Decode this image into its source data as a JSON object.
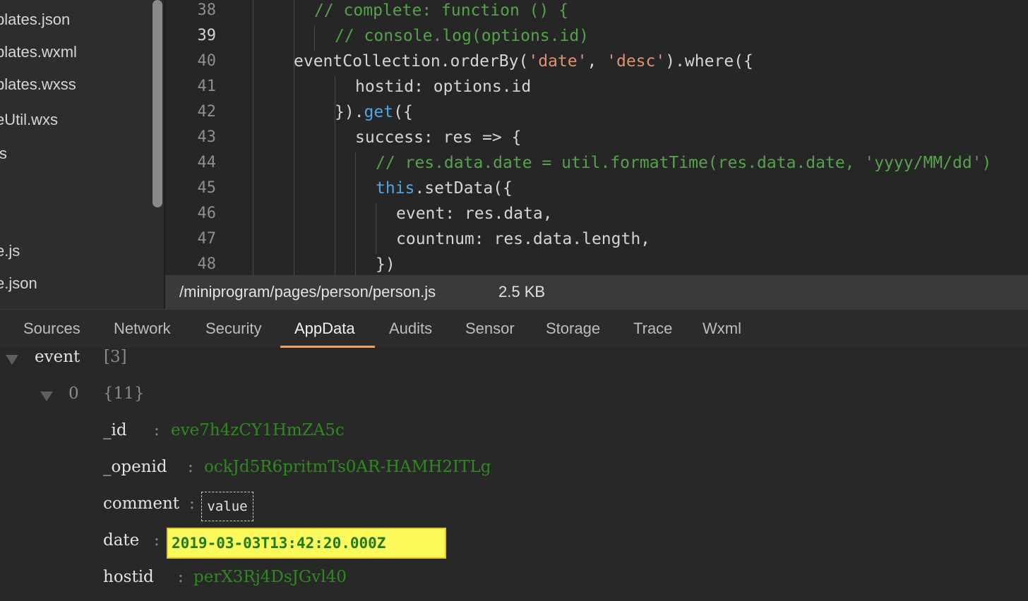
{
  "file_tree": {
    "items": [
      "plates.json",
      "plates.wxml",
      "plates.wxss",
      "eUtil.wxs",
      "js",
      "e.js",
      "e.json"
    ]
  },
  "editor": {
    "lines": [
      {
        "num": "38",
        "tokens": [
          {
            "t": "// complete: function () {",
            "c": "comment"
          }
        ]
      },
      {
        "num": "39",
        "tokens": [
          {
            "t": "// console.log(options.id)",
            "c": "comment"
          }
        ]
      },
      {
        "num": "40",
        "tokens": [
          {
            "t": "eventCollection.orderBy(",
            "c": "plain"
          },
          {
            "t": "'date'",
            "c": "str"
          },
          {
            "t": ", ",
            "c": "plain"
          },
          {
            "t": "'desc'",
            "c": "str"
          },
          {
            "t": ").where({",
            "c": "plain"
          }
        ]
      },
      {
        "num": "41",
        "tokens": [
          {
            "t": "hostid: options.id",
            "c": "plain"
          }
        ]
      },
      {
        "num": "42",
        "tokens": [
          {
            "t": "}).",
            "c": "plain"
          },
          {
            "t": "get",
            "c": "kw"
          },
          {
            "t": "({",
            "c": "plain"
          }
        ]
      },
      {
        "num": "43",
        "tokens": [
          {
            "t": "success: res => {",
            "c": "plain"
          }
        ]
      },
      {
        "num": "44",
        "tokens": [
          {
            "t": "// res.data.date = util.formatTime(res.data.date, 'yyyy/MM/dd')",
            "c": "comment"
          }
        ]
      },
      {
        "num": "45",
        "tokens": [
          {
            "t": "this",
            "c": "kw"
          },
          {
            "t": ".setData({",
            "c": "plain"
          }
        ]
      },
      {
        "num": "46",
        "tokens": [
          {
            "t": "event: res.data,",
            "c": "plain"
          }
        ]
      },
      {
        "num": "47",
        "tokens": [
          {
            "t": "countnum: res.data.length,",
            "c": "plain"
          }
        ]
      },
      {
        "num": "48",
        "tokens": [
          {
            "t": "})",
            "c": "plain"
          }
        ]
      }
    ],
    "active_line": "39"
  },
  "status": {
    "path": "/miniprogram/pages/person/person.js",
    "size": "2.5 KB"
  },
  "tabs": {
    "items": [
      "Sources",
      "Network",
      "Security",
      "AppData",
      "Audits",
      "Sensor",
      "Storage",
      "Trace",
      "Wxml"
    ],
    "active": "AppData"
  },
  "appdata": {
    "root_key": "event",
    "root_count": "[3]",
    "item_index": "0",
    "item_count": "{11}",
    "fields": [
      {
        "key": "_id",
        "value": "eve7h4zCY1HmZA5c"
      },
      {
        "key": "_openid",
        "value": "ockJd5R6pritmTs0AR-HAMH2ITLg"
      },
      {
        "key": "comment",
        "value": "value"
      },
      {
        "key": "date",
        "value": "2019-03-03T13:42:20.000Z"
      },
      {
        "key": "hostid",
        "value": "perX3Rj4DsJGvl40"
      }
    ]
  },
  "colors": {
    "comment": "#54a34a",
    "string": "#e0916d",
    "keyword": "#4fa7e3",
    "value_green": "#2f8a1e",
    "tab_accent": "#f0a25a",
    "highlight": "#fcfa5a"
  }
}
